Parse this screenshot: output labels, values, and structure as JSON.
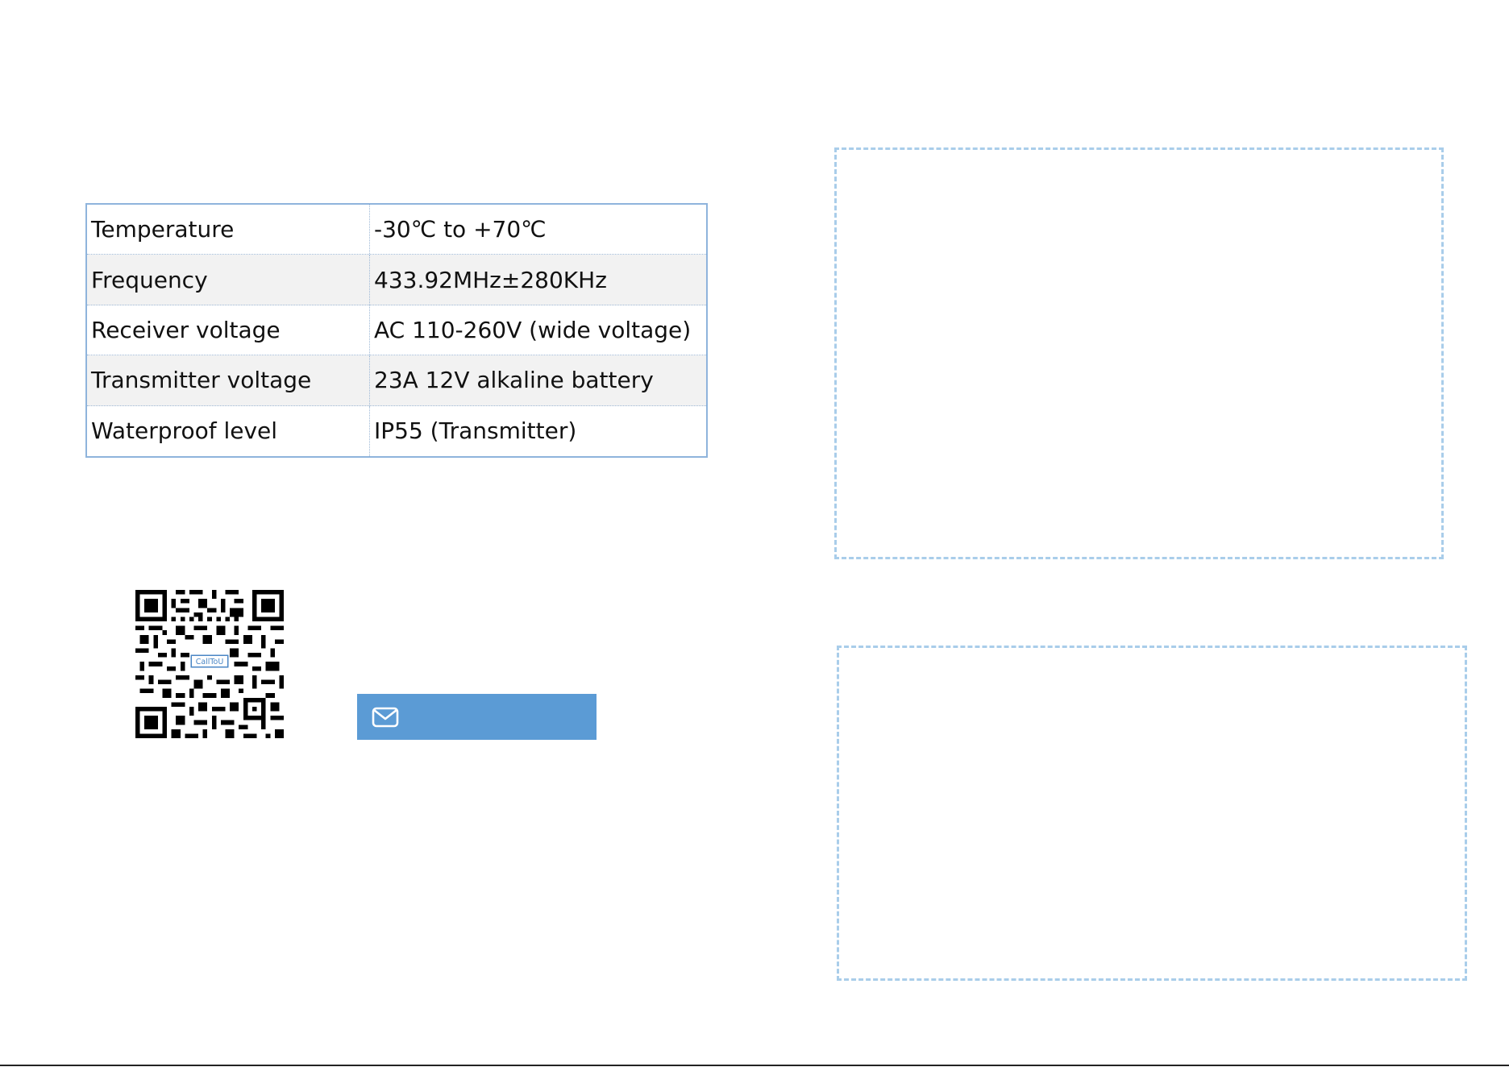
{
  "spec_table": {
    "rows": [
      {
        "label": "Temperature",
        "value": "-30℃ to +70℃"
      },
      {
        "label": "Frequency",
        "value": "433.92MHz±280KHz"
      },
      {
        "label": "Receiver voltage",
        "value": "AC 110-260V (wide voltage)"
      },
      {
        "label": "Transmitter voltage",
        "value": "23A 12V alkaline battery"
      },
      {
        "label": "Waterproof level",
        "value": "IP55 (Transmitter)"
      }
    ]
  },
  "qr_code": {
    "center_logo_text": "CallToU"
  },
  "email_button": {
    "icon": "envelope-icon",
    "color": "#5b9bd5"
  },
  "colors": {
    "table_border": "#8fb4dc",
    "dashed_border": "#a9cdea",
    "row_alt_bg": "#f2f2f2"
  }
}
